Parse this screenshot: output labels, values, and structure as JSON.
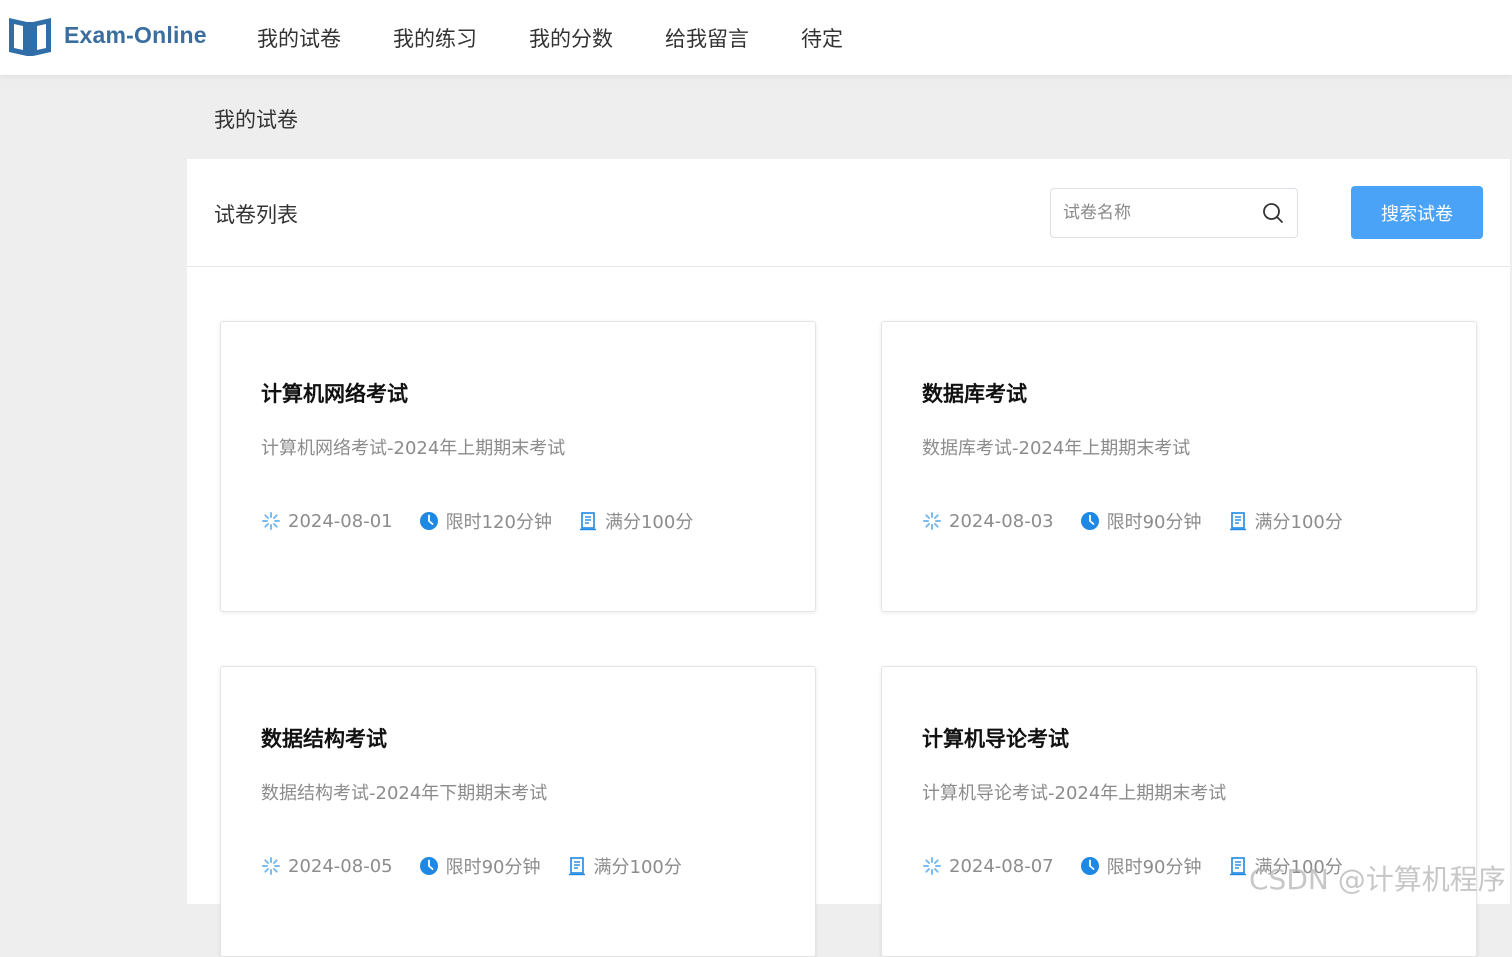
{
  "header": {
    "logo_text": "Exam-Online",
    "nav": [
      "我的试卷",
      "我的练习",
      "我的分数",
      "给我留言",
      "待定"
    ]
  },
  "page": {
    "title": "我的试卷"
  },
  "panel": {
    "title": "试卷列表",
    "search": {
      "placeholder": "试卷名称",
      "value": ""
    },
    "search_button": "搜索试卷"
  },
  "cards": [
    {
      "title": "计算机网络考试",
      "desc": "计算机网络考试-2024年上期期末考试",
      "date": "2024-08-01",
      "duration": "限时120分钟",
      "score": "满分100分"
    },
    {
      "title": "数据库考试",
      "desc": "数据库考试-2024年上期期末考试",
      "date": "2024-08-03",
      "duration": "限时90分钟",
      "score": "满分100分"
    },
    {
      "title": "数据结构考试",
      "desc": "数据结构考试-2024年下期期末考试",
      "date": "2024-08-05",
      "duration": "限时90分钟",
      "score": "满分100分"
    },
    {
      "title": "计算机导论考试",
      "desc": "计算机导论考试-2024年上期期末考试",
      "date": "2024-08-07",
      "duration": "限时90分钟",
      "score": "满分100分"
    }
  ],
  "watermark": "CSDN @计算机程序",
  "colors": {
    "accent": "#4ba3f7",
    "logo": "#3a6e9f",
    "icon_blue": "#1e88e5"
  }
}
